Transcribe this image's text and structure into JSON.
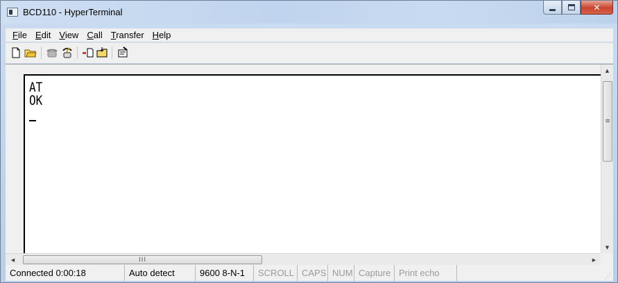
{
  "window": {
    "title": "BCD110 - HyperTerminal"
  },
  "menu": [
    {
      "label": "File",
      "key": "F",
      "rest": "ile"
    },
    {
      "label": "Edit",
      "key": "E",
      "rest": "dit"
    },
    {
      "label": "View",
      "key": "V",
      "rest": "iew"
    },
    {
      "label": "Call",
      "key": "C",
      "rest": "all"
    },
    {
      "label": "Transfer",
      "key": "T",
      "rest": "ransfer"
    },
    {
      "label": "Help",
      "key": "H",
      "rest": "elp"
    }
  ],
  "toolbar": {
    "icons": [
      "new-connection-icon",
      "open-icon",
      "call-icon",
      "disconnect-icon",
      "send-icon",
      "receive-icon",
      "properties-icon"
    ]
  },
  "terminal": {
    "lines": [
      "AT",
      "OK"
    ],
    "cursor": "_"
  },
  "status": {
    "connected": "Connected 0:00:18",
    "detect": "Auto detect",
    "port": "9600 8-N-1",
    "scroll": "SCROLL",
    "caps": "CAPS",
    "num": "NUM",
    "capture": "Capture",
    "print_echo": "Print echo"
  }
}
